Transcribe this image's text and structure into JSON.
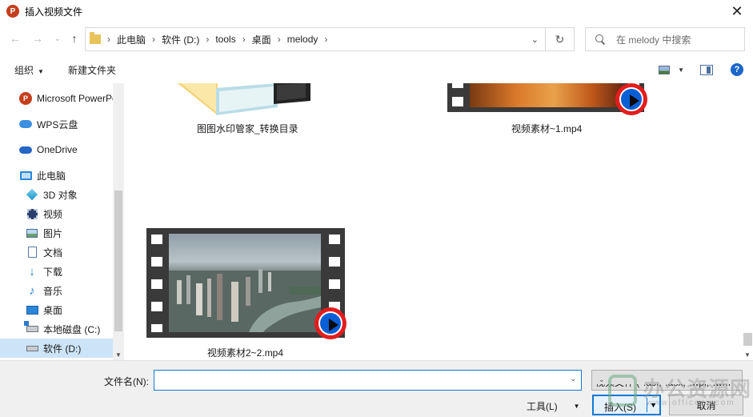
{
  "window": {
    "title": "插入视频文件",
    "app_icon_letter": "P",
    "close_glyph": "✕"
  },
  "address_bar": {
    "back_glyph": "←",
    "forward_glyph": "→",
    "history_glyph": "⌄",
    "up_glyph": "↑",
    "crumbs": [
      "此电脑",
      "软件 (D:)",
      "tools",
      "桌面",
      "melody"
    ],
    "separator": "›",
    "dropdown_glyph": "⌄",
    "refresh_glyph": "↻"
  },
  "search": {
    "placeholder": "在 melody 中搜索"
  },
  "toolbar": {
    "organize_label": "组织",
    "organize_caret": "▼",
    "new_folder_label": "新建文件夹",
    "view_caret": "▼",
    "help_glyph": "?"
  },
  "nav": {
    "items": [
      {
        "label": "Microsoft PowerPoint",
        "icon": "powerpoint-icon"
      },
      {
        "label": "WPS云盘",
        "icon": "cloud-icon"
      },
      {
        "label": "OneDrive",
        "icon": "onedrive-icon"
      },
      {
        "label": "此电脑",
        "icon": "computer-icon"
      },
      {
        "label": "3D 对象",
        "icon": "3d-objects-icon"
      },
      {
        "label": "视频",
        "icon": "videos-icon"
      },
      {
        "label": "图片",
        "icon": "pictures-icon"
      },
      {
        "label": "文档",
        "icon": "documents-icon"
      },
      {
        "label": "下载",
        "icon": "downloads-icon"
      },
      {
        "label": "音乐",
        "icon": "music-icon"
      },
      {
        "label": "桌面",
        "icon": "desktop-icon"
      },
      {
        "label": "本地磁盘 (C:)",
        "icon": "local-disk-icon"
      },
      {
        "label": "软件 (D:)",
        "icon": "drive-icon",
        "selected": true
      }
    ],
    "scroll_down_glyph": "▼"
  },
  "files": [
    {
      "name": "图图水印管家_转换目录",
      "type": "folder"
    },
    {
      "name": "视频素材~1.mp4",
      "type": "video"
    },
    {
      "name": "视频素材2~2.mp4",
      "type": "video"
    }
  ],
  "colors": {
    "accent": "#0f78d6",
    "selected_bg": "#cce4f7",
    "play_red": "#e31d1d",
    "play_blue": "#0a5fd6"
  },
  "footer": {
    "filename_label": "文件名(N):",
    "filename_value": "",
    "filetype_value": "视频文件 (*.asf;*.asx;*.wpl;*.wm",
    "dropdown_glyph": "⌄",
    "tools_label": "工具(L)",
    "tools_caret": "▼",
    "insert_label": "插入(S)",
    "insert_caret": "▼",
    "cancel_label": "取消"
  },
  "watermark": {
    "text": "办公资源网",
    "url": "www.officezy.com"
  }
}
